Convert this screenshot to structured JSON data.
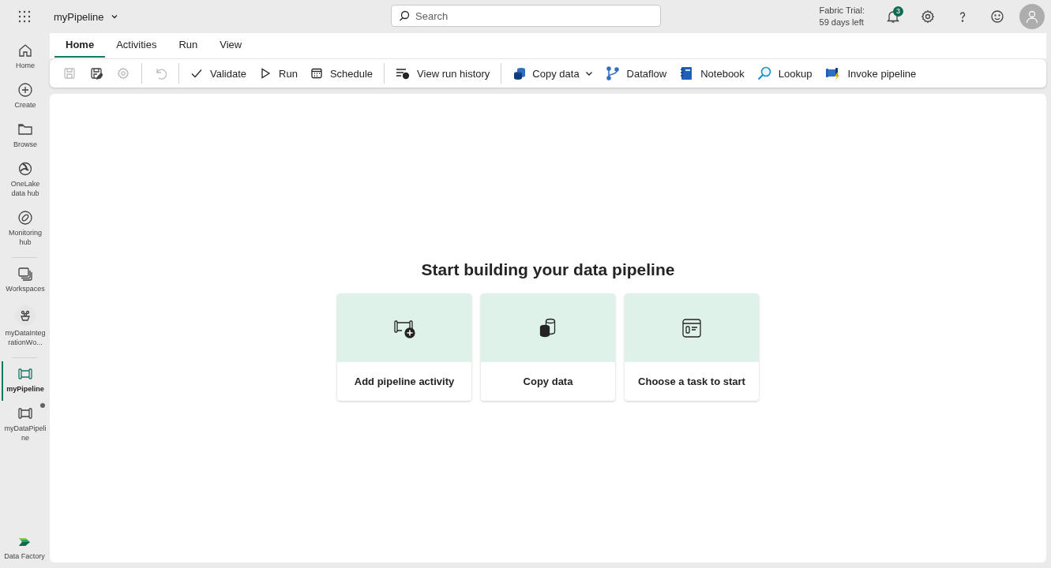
{
  "top_bar": {
    "item_name": "myPipeline",
    "search": {
      "placeholder": "Search"
    },
    "trial_label": "Fabric Trial:",
    "trial_remaining": "59 days left",
    "notification_count": "3"
  },
  "nav_rail": {
    "groups": [
      [
        {
          "label": "Home",
          "selected": false,
          "modified": false
        },
        {
          "label": "Create",
          "selected": false,
          "modified": false
        },
        {
          "label": "Browse",
          "selected": false,
          "modified": false
        },
        {
          "label": "OneLake data hub",
          "selected": false,
          "modified": false
        },
        {
          "label": "Monitoring hub",
          "selected": false,
          "modified": false
        }
      ],
      [
        {
          "label": "Workspaces",
          "selected": false,
          "modified": false
        },
        {
          "label": "myDataIntegrationWo...",
          "selected": false,
          "modified": false
        }
      ],
      [
        {
          "label": "myPipeline",
          "selected": true,
          "modified": false
        },
        {
          "label": "myDataPipeline",
          "selected": false,
          "modified": true
        }
      ]
    ],
    "footer": "Data Factory"
  },
  "tabs": [
    {
      "label": "Home",
      "selected": true
    },
    {
      "label": "Activities",
      "selected": false
    },
    {
      "label": "Run",
      "selected": false
    },
    {
      "label": "View",
      "selected": false
    }
  ],
  "toolbar": {
    "groups": [
      [
        {
          "kind": "icon",
          "disabled": true
        },
        {
          "kind": "icon",
          "disabled": false
        },
        {
          "kind": "icon",
          "disabled": true
        }
      ],
      [
        {
          "kind": "icon",
          "disabled": true
        }
      ],
      [
        {
          "kind": "button",
          "label": "Validate",
          "disabled": false
        },
        {
          "kind": "button",
          "label": "Run",
          "disabled": false
        },
        {
          "kind": "button",
          "label": "Schedule",
          "disabled": false
        }
      ],
      [
        {
          "kind": "button",
          "label": "View run history",
          "disabled": false
        }
      ],
      [
        {
          "kind": "dropdown",
          "label": "Copy data",
          "disabled": false
        },
        {
          "kind": "button",
          "label": "Dataflow",
          "disabled": false
        },
        {
          "kind": "button",
          "label": "Notebook",
          "disabled": false
        },
        {
          "kind": "button",
          "label": "Lookup",
          "disabled": false
        },
        {
          "kind": "button",
          "label": "Invoke pipeline",
          "disabled": false
        }
      ]
    ]
  },
  "canvas": {
    "heading": "Start building your data pipeline",
    "cards": [
      {
        "label": "Add pipeline activity"
      },
      {
        "label": "Copy data"
      },
      {
        "label": "Choose a task to start"
      }
    ]
  }
}
